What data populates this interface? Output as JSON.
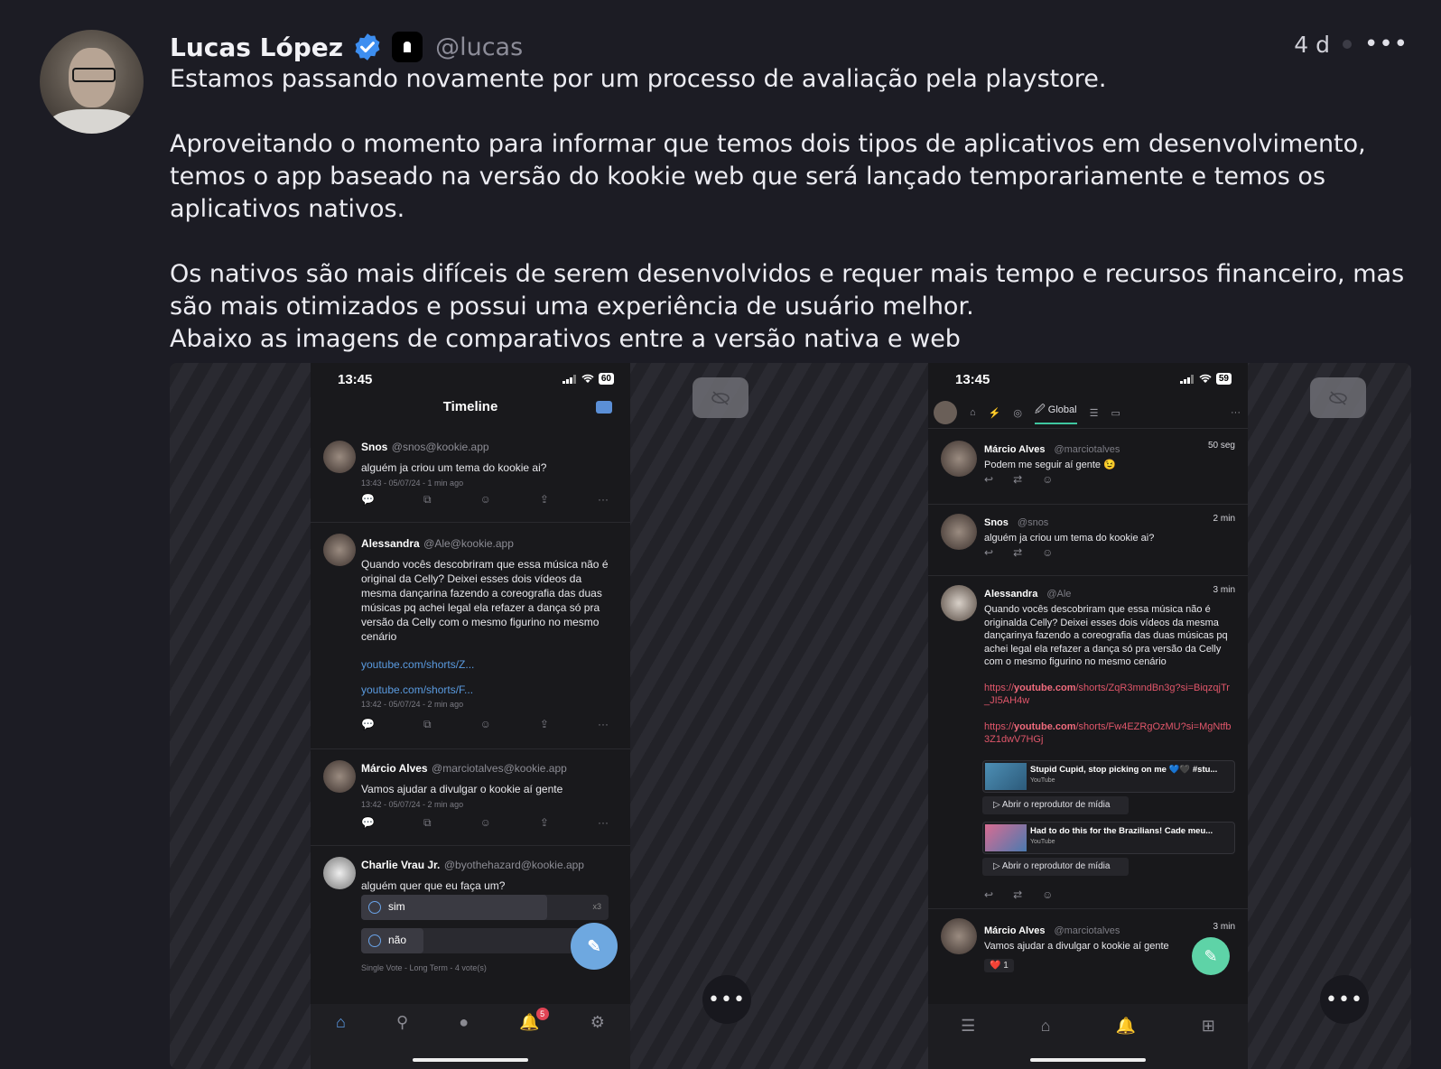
{
  "author": {
    "name": "Lucas López",
    "handle": "@lucas"
  },
  "post_meta": {
    "time": "4 d",
    "more": "•••"
  },
  "content": {
    "p1": "Estamos passando novamente por um processo de avaliação pela playstore.",
    "p2": "Aproveitando o momento para informar que temos dois tipos de aplicativos em desenvolvimento,\ntemos o app baseado na versão do kookie web que será lançado temporariamente e temos os\naplicativos nativos.",
    "p3": "Os nativos são mais difíceis de serem desenvolvidos e requer mais tempo e recursos financeiro, mas\nsão mais otimizados e possui uma experiência de usuário melhor.\nAbaixo as imagens de comparativos entre a versão nativa e web"
  },
  "media_controls": {
    "more": "•••"
  },
  "left_phone": {
    "time": "13:45",
    "battery": "60",
    "title": "Timeline",
    "posts": [
      {
        "name": "Snos",
        "handle": "@snos@kookie.app",
        "text": "alguém ja criou um tema do kookie ai?",
        "sub": "13:43 - 05/07/24 - 1 min ago"
      },
      {
        "name": "Alessandra",
        "handle": "@Ale@kookie.app",
        "text": "Quando vocês descobriram que essa música não é original da Celly? Deixei esses dois vídeos da mesma dançarina fazendo a coreografia das duas músicas pq achei legal ela refazer a dança só pra versão da Celly com o mesmo figurino no mesmo cenário",
        "link1": "youtube.com/shorts/Z...",
        "link2": "youtube.com/shorts/F...",
        "sub": "13:42 - 05/07/24 - 2 min ago"
      },
      {
        "name": "Márcio Alves",
        "handle": "@marciotalves@kookie.app",
        "text": "Vamos ajudar a divulgar o kookie aí gente",
        "sub": "13:42 - 05/07/24 - 2 min ago"
      },
      {
        "name": "Charlie Vrau Jr.",
        "handle": "@byothehazard@kookie.app",
        "text": "alguém quer que eu faça um?",
        "poll": [
          {
            "label": "sim",
            "count": "x3",
            "fraction": 0.75
          },
          {
            "label": "não",
            "count": "",
            "fraction": 0.25
          }
        ],
        "sub": "Single Vote - Long Term - 4 vote(s)"
      }
    ],
    "notification_count": "5"
  },
  "right_phone": {
    "time": "13:45",
    "battery": "59",
    "tab_active": "Global",
    "posts": [
      {
        "name": "Márcio Alves",
        "handle": "@marciotalves",
        "time": "50 seg",
        "text": "Podem me seguir aí gente 😉"
      },
      {
        "name": "Snos",
        "handle": "@snos",
        "time": "2 min",
        "text": "alguém ja criou um tema do kookie ai?"
      },
      {
        "name": "Alessandra",
        "handle": "@Ale",
        "time": "3 min",
        "text": "Quando vocês descobriram que essa música não é originalda Celly? Deixei esses dois vídeos da mesma dançarinya fazendo a coreografia das duas músicas pq achei legal ela refazer a dança só pra versão da Celly com o mesmo figurino no mesmo cenário",
        "link1_prefix": "https://",
        "link1_domain": "youtube.com",
        "link1_rest": "/shorts/ZqR3mndBn3g?si=BiqzqjTr_JI5AH4w",
        "link2_prefix": "https://",
        "link2_domain": "youtube.com",
        "link2_rest": "/shorts/Fw4EZRgOzMU?si=MgNtfb3Z1dwV7HGj",
        "card1_title": "Stupid Cupid, stop picking on me 💙🖤 #stu...",
        "card2_title": "Had to do this for the Brazilians! Cade meu...",
        "card_source": "YouTube",
        "open_player": "▷ Abrir o reprodutor de mídia"
      },
      {
        "name": "Márcio Alves",
        "handle": "@marciotalves",
        "time": "3 min",
        "text": "Vamos ajudar a divulgar o kookie aí gente",
        "reaction": "❤️ 1"
      }
    ]
  }
}
